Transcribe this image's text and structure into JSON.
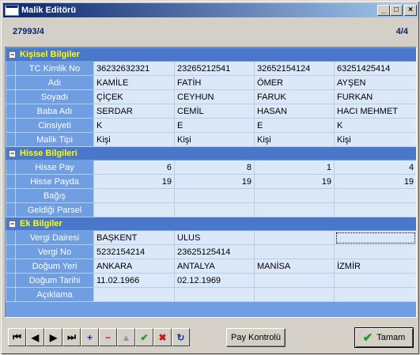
{
  "window": {
    "title": "Malik Editörü"
  },
  "header": {
    "record_id": "27993/4",
    "page": "4/4"
  },
  "sections": [
    {
      "expander": "−",
      "title": "Kişisel Bilgiler"
    },
    {
      "expander": "−",
      "title": "Hisse Bilgileri"
    },
    {
      "expander": "−",
      "title": "Ek Bilgiler"
    }
  ],
  "personal": {
    "rows": [
      {
        "label": "TC Kimlik No",
        "values": [
          "36232632321",
          "23265212541",
          "32652154124",
          "63251425414"
        ]
      },
      {
        "label": "Adı",
        "values": [
          "KAMİLE",
          "FATİH",
          "ÖMER",
          "AYŞEN"
        ]
      },
      {
        "label": "Soyadı",
        "values": [
          "ÇİÇEK",
          "CEYHUN",
          "FARUK",
          "FURKAN"
        ]
      },
      {
        "label": "Baba Adı",
        "values": [
          "SERDAR",
          "CEMİL",
          "HASAN",
          "HACI MEHMET"
        ]
      },
      {
        "label": "Cinsiyeti",
        "values": [
          "K",
          "E",
          "E",
          "K"
        ]
      },
      {
        "label": "Malik Tipi",
        "values": [
          "Kişi",
          "Kişi",
          "Kişi",
          "Kişi"
        ]
      }
    ]
  },
  "share": {
    "rows": [
      {
        "label": "Hisse Pay",
        "values": [
          "6",
          "8",
          "1",
          "4"
        ]
      },
      {
        "label": "Hisse Payda",
        "values": [
          "19",
          "19",
          "19",
          "19"
        ]
      },
      {
        "label": "Bağış",
        "values": [
          "",
          "",
          "",
          ""
        ]
      },
      {
        "label": "Geldiği Parsel",
        "values": [
          "",
          "",
          "",
          ""
        ]
      }
    ]
  },
  "extra": {
    "rows": [
      {
        "label": "Vergi Dairesi",
        "values": [
          "BAŞKENT",
          "ULUS",
          "",
          ""
        ]
      },
      {
        "label": "Vergi No",
        "values": [
          "5232154214",
          "23625125414",
          "",
          ""
        ]
      },
      {
        "label": "Doğum Yeri",
        "values": [
          "ANKARA",
          "ANTALYA",
          "MANİSA",
          "İZMİR"
        ]
      },
      {
        "label": "Doğum Tarihi",
        "values": [
          "11.02.1966",
          "02.12.1969",
          "",
          ""
        ]
      },
      {
        "label": "Açıklama",
        "values": [
          "",
          "",
          "",
          ""
        ]
      }
    ]
  },
  "toolbar": {
    "nav": [
      {
        "icon": "first-record-icon",
        "glyph": "⏮"
      },
      {
        "icon": "prev-record-icon",
        "glyph": "◀"
      },
      {
        "icon": "next-record-icon",
        "glyph": "▶"
      },
      {
        "icon": "last-record-icon",
        "glyph": "⏭"
      },
      {
        "icon": "add-icon",
        "glyph": "+"
      },
      {
        "icon": "remove-icon",
        "glyph": "−"
      },
      {
        "icon": "move-up-icon",
        "glyph": "▲"
      },
      {
        "icon": "confirm-icon",
        "glyph": "✔"
      },
      {
        "icon": "cancel-icon",
        "glyph": "✖"
      },
      {
        "icon": "refresh-icon",
        "glyph": "↻"
      }
    ],
    "pay_check_label": "Pay Kontrolü",
    "ok_label": "Tamam"
  },
  "colors": {
    "section_bg": "#4977c9",
    "section_text": "#ffff00",
    "row_header_bg": "#6f9ee3",
    "cell_bg": "#dbe8f8"
  }
}
